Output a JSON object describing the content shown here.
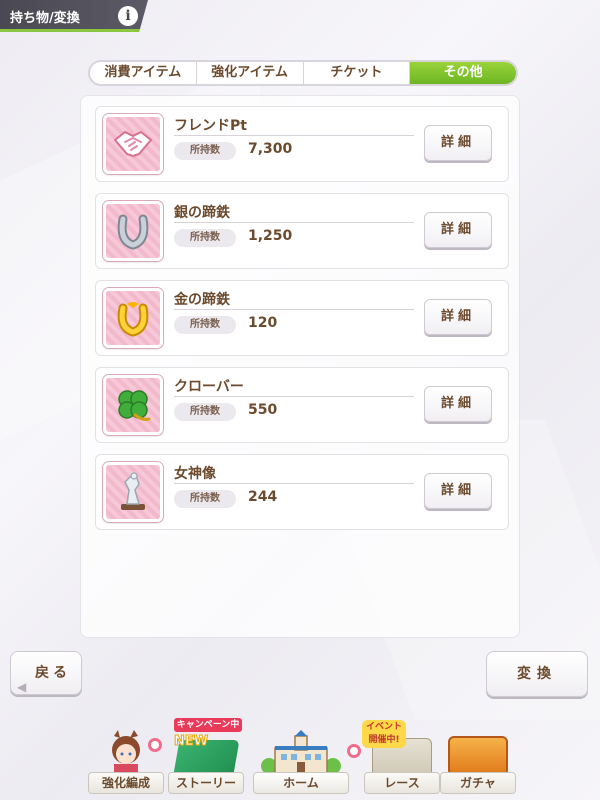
{
  "header": {
    "title": "持ち物/変換",
    "info_label": "i"
  },
  "tabs": [
    {
      "label": "消費アイテム",
      "active": false
    },
    {
      "label": "強化アイテム",
      "active": false
    },
    {
      "label": "チケット",
      "active": false
    },
    {
      "label": "その他",
      "active": true
    }
  ],
  "items": [
    {
      "name": "フレンドPt",
      "count_label": "所持数",
      "count": "7,300",
      "icon": "handshake-icon",
      "detail_label": "詳細"
    },
    {
      "name": "銀の蹄鉄",
      "count_label": "所持数",
      "count": "1,250",
      "icon": "silver-horseshoe-icon",
      "detail_label": "詳細"
    },
    {
      "name": "金の蹄鉄",
      "count_label": "所持数",
      "count": "120",
      "icon": "gold-horseshoe-icon",
      "detail_label": "詳細"
    },
    {
      "name": "クローバー",
      "count_label": "所持数",
      "count": "550",
      "icon": "clover-icon",
      "detail_label": "詳細"
    },
    {
      "name": "女神像",
      "count_label": "所持数",
      "count": "244",
      "icon": "goddess-statue-icon",
      "detail_label": "詳細"
    }
  ],
  "buttons": {
    "back": "戻る",
    "exchange": "変換"
  },
  "nav": {
    "items": [
      {
        "label": "強化編成",
        "icon": "character-icon"
      },
      {
        "label": "ストーリー",
        "icon": "story-book-icon",
        "tag": "キャンペーン中",
        "badge": "NEW"
      },
      {
        "label": "ホーム",
        "icon": "school-building-icon"
      },
      {
        "label": "レース",
        "icon": "race-icon",
        "tag": "イベント開催中!"
      },
      {
        "label": "ガチャ",
        "icon": "gacha-icon"
      }
    ]
  },
  "colors": {
    "accent_green": "#7cc42c",
    "brown_text": "#6b4a2e",
    "tab_active": "#7cc42c",
    "icon_pink": "#f6c8d8"
  }
}
